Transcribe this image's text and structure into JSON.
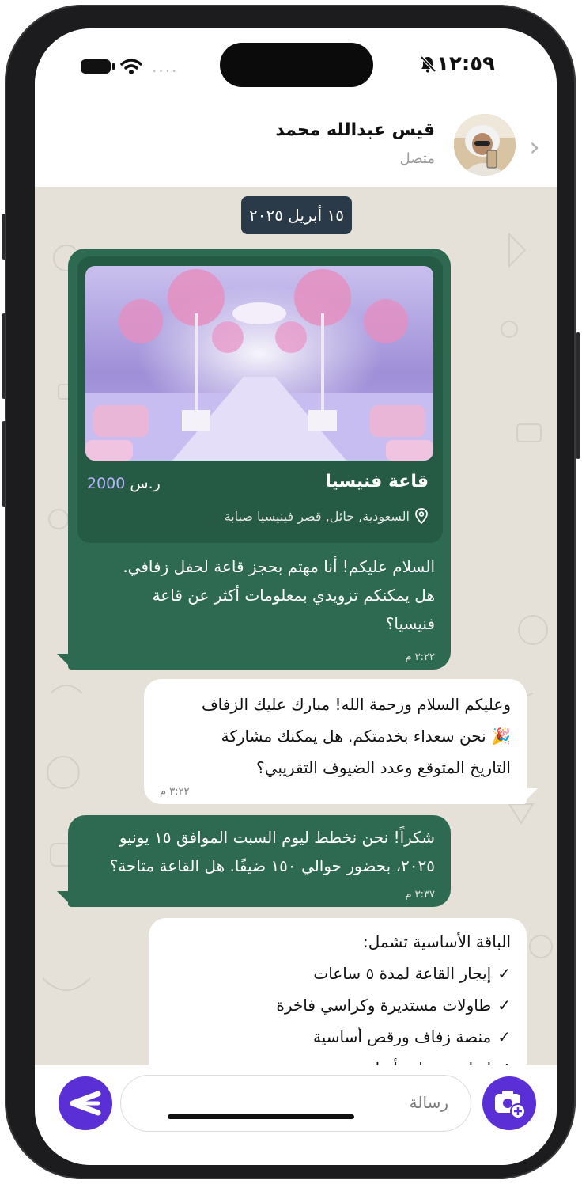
{
  "status_bar": {
    "time": "١٢:٥٩",
    "signal_dots": "....",
    "icons": [
      "battery-icon",
      "wifi-icon",
      "bell-slash-icon"
    ]
  },
  "header": {
    "name": "قيس عبدالله محمد",
    "status": "متصل",
    "back_icon": "chevron-right-icon"
  },
  "chat": {
    "date_chip": "١٥ أبريل ٢٠٢٥",
    "venue_card": {
      "name": "قاعة فنيسيا",
      "price_value": "2000",
      "price_unit": "ر.س",
      "location": "السعودية, حائل, قصر فينيسيا صبابة"
    },
    "messages": [
      {
        "dir": "out",
        "lines": [
          "السلام عليكم! أنا مهتم بحجز قاعة لحفل زفافي.",
          "هل يمكنكم تزويدي بمعلومات أكثر عن قاعة",
          "فنيسيا؟"
        ],
        "time": "٣:٢٢ م"
      },
      {
        "dir": "in",
        "lines": [
          "وعليكم السلام ورحمة الله! مبارك عليك الزفاف",
          "🎉 نحن سعداء بخدمتكم. هل يمكنك مشاركة",
          "التاريخ المتوقع وعدد الضيوف التقريبي؟"
        ],
        "time": "٣:٢٢ م"
      },
      {
        "dir": "out",
        "lines": [
          "شكراً! نحن نخطط ليوم السبت الموافق ١٥ يونيو",
          "٢٠٢٥، بحضور حوالي ١٥٠ ضيفًا. هل القاعة متاحة؟"
        ],
        "time": "٣:٣٧ م"
      },
      {
        "dir": "in",
        "title": "الباقة الأساسية تشمل:",
        "items": [
          "إيجار القاعة لمدة ٥ ساعات",
          "طاولات مستديرة وكراسي فاخرة",
          "منصة زفاف ورقص أساسية",
          "إضاءة وتنظيم أساسي"
        ]
      }
    ]
  },
  "composer": {
    "placeholder": "رسالة",
    "send_icon": "send-icon",
    "camera_icon": "camera-add-icon"
  },
  "colors": {
    "outgoing": "#2e6a52",
    "incoming": "#ffffff",
    "accent": "#5b2fd6",
    "chat_bg": "#e6e1d8",
    "price": "#b9b4ff"
  }
}
